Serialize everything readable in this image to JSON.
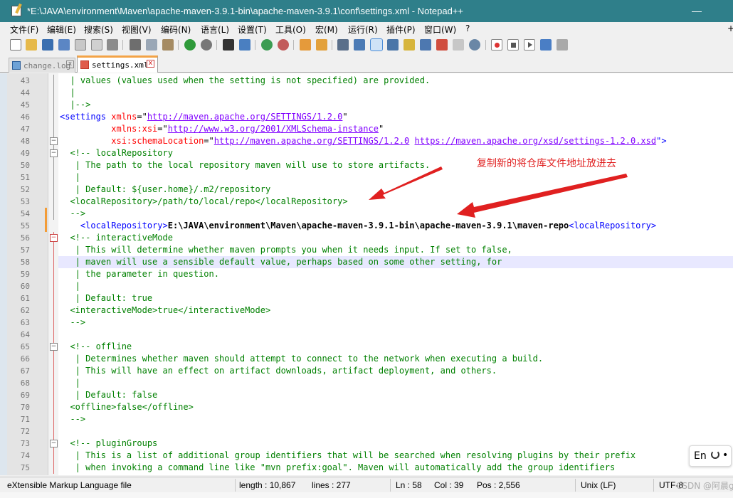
{
  "window": {
    "title": "*E:\\JAVA\\environment\\Maven\\apache-maven-3.9.1-bin\\apache-maven-3.9.1\\conf\\settings.xml - Notepad++",
    "min_glyph": "—"
  },
  "menu": [
    "文件(F)",
    "编辑(E)",
    "搜索(S)",
    "视图(V)",
    "编码(N)",
    "语言(L)",
    "设置(T)",
    "工具(O)",
    "宏(M)",
    "运行(R)",
    "插件(P)",
    "窗口(W)",
    "?"
  ],
  "menu_close": "+",
  "tabs": [
    {
      "label": "change.log",
      "close": "x",
      "active": false
    },
    {
      "label": "settings.xml",
      "close": "x",
      "active": true
    }
  ],
  "lines": [
    {
      "n": "43",
      "segs": [
        {
          "t": "  | values (values used when the setting is not specified) are provided.",
          "c": "cm"
        }
      ]
    },
    {
      "n": "44",
      "segs": [
        {
          "t": "  |",
          "c": "cm"
        }
      ]
    },
    {
      "n": "45",
      "segs": [
        {
          "t": "  |-->",
          "c": "cm"
        }
      ]
    },
    {
      "n": "46",
      "segs": [
        {
          "t": "<settings ",
          "c": "tg"
        },
        {
          "t": "xmlns",
          "c": "at"
        },
        {
          "t": "=\"",
          "c": "tx"
        },
        {
          "t": "http://maven.apache.org/SETTINGS/1.2.0",
          "c": "av"
        },
        {
          "t": "\"",
          "c": "tx"
        }
      ]
    },
    {
      "n": "47",
      "segs": [
        {
          "t": "          ",
          "c": "tx"
        },
        {
          "t": "xmlns:xsi",
          "c": "at"
        },
        {
          "t": "=\"",
          "c": "tx"
        },
        {
          "t": "http://www.w3.org/2001/XMLSchema-instance",
          "c": "av"
        },
        {
          "t": "\"",
          "c": "tx"
        }
      ]
    },
    {
      "n": "48",
      "segs": [
        {
          "t": "          ",
          "c": "tx"
        },
        {
          "t": "xsi:schemaLocation",
          "c": "at"
        },
        {
          "t": "=\"",
          "c": "tx"
        },
        {
          "t": "http://maven.apache.org/SETTINGS/1.2.0",
          "c": "av"
        },
        {
          "t": " ",
          "c": "tx"
        },
        {
          "t": "https://maven.apache.org/xsd/settings-1.2.0.xsd",
          "c": "av"
        },
        {
          "t": "\">",
          "c": "tg"
        }
      ]
    },
    {
      "n": "49",
      "segs": [
        {
          "t": "  <!-- localRepository",
          "c": "cm"
        }
      ]
    },
    {
      "n": "50",
      "segs": [
        {
          "t": "   | The path to the local repository maven will use to store artifacts.",
          "c": "cm"
        }
      ]
    },
    {
      "n": "51",
      "segs": [
        {
          "t": "   |",
          "c": "cm"
        }
      ]
    },
    {
      "n": "52",
      "segs": [
        {
          "t": "   | Default: ${user.home}/.m2/repository",
          "c": "cm"
        }
      ]
    },
    {
      "n": "53",
      "segs": [
        {
          "t": "  <localRepository>/path/to/local/repo</localRepository>",
          "c": "cm"
        }
      ]
    },
    {
      "n": "54",
      "segs": [
        {
          "t": "  -->",
          "c": "cm"
        }
      ]
    },
    {
      "n": "55",
      "segs": [
        {
          "t": "    ",
          "c": "tx"
        },
        {
          "t": "<localRepository>",
          "c": "tg"
        },
        {
          "t": "E:\\JAVA\\environment\\Maven\\apache-maven-3.9.1-bin\\apache-maven-3.9.1\\maven-repo",
          "c": "tx bold"
        },
        {
          "t": "<localRepository>",
          "c": "tg"
        }
      ]
    },
    {
      "n": "56",
      "segs": [
        {
          "t": "  <!-- interactiveMode",
          "c": "cm"
        }
      ]
    },
    {
      "n": "57",
      "segs": [
        {
          "t": "   | This will determine whether maven prompts you when it needs input. If set to false,",
          "c": "cm"
        }
      ]
    },
    {
      "n": "58",
      "segs": [
        {
          "t": "   | maven will use a sensible default value, perhaps based on some other setting, for",
          "c": "cm"
        }
      ]
    },
    {
      "n": "59",
      "segs": [
        {
          "t": "   | the parameter in question.",
          "c": "cm"
        }
      ]
    },
    {
      "n": "60",
      "segs": [
        {
          "t": "   |",
          "c": "cm"
        }
      ]
    },
    {
      "n": "61",
      "segs": [
        {
          "t": "   | Default: true",
          "c": "cm"
        }
      ]
    },
    {
      "n": "62",
      "segs": [
        {
          "t": "  <interactiveMode>true</interactiveMode>",
          "c": "cm"
        }
      ]
    },
    {
      "n": "63",
      "segs": [
        {
          "t": "  -->",
          "c": "cm"
        }
      ]
    },
    {
      "n": "64",
      "segs": [
        {
          "t": "",
          "c": "cm"
        }
      ]
    },
    {
      "n": "65",
      "segs": [
        {
          "t": "  <!-- offline",
          "c": "cm"
        }
      ]
    },
    {
      "n": "66",
      "segs": [
        {
          "t": "   | Determines whether maven should attempt to connect to the network when executing a build.",
          "c": "cm"
        }
      ]
    },
    {
      "n": "67",
      "segs": [
        {
          "t": "   | This will have an effect on artifact downloads, artifact deployment, and others.",
          "c": "cm"
        }
      ]
    },
    {
      "n": "68",
      "segs": [
        {
          "t": "   |",
          "c": "cm"
        }
      ]
    },
    {
      "n": "69",
      "segs": [
        {
          "t": "   | Default: false",
          "c": "cm"
        }
      ]
    },
    {
      "n": "70",
      "segs": [
        {
          "t": "  <offline>false</offline>",
          "c": "cm"
        }
      ]
    },
    {
      "n": "71",
      "segs": [
        {
          "t": "  -->",
          "c": "cm"
        }
      ]
    },
    {
      "n": "72",
      "segs": [
        {
          "t": "",
          "c": "cm"
        }
      ]
    },
    {
      "n": "73",
      "segs": [
        {
          "t": "  <!-- pluginGroups",
          "c": "cm"
        }
      ]
    },
    {
      "n": "74",
      "segs": [
        {
          "t": "   | This is a list of additional group identifiers that will be searched when resolving plugins by their prefix",
          "c": "cm"
        }
      ]
    },
    {
      "n": "75",
      "segs": [
        {
          "t": "   | when invoking a command line like \"mvn prefix:goal\". Maven will automatically add the group identifiers",
          "c": "cm"
        }
      ]
    }
  ],
  "annotation": "复制新的将仓库文件地址放进去",
  "status": {
    "filetype": "eXtensible Markup Language file",
    "length": "length : 10,867",
    "lines": "lines : 277",
    "ln": "Ln : 58",
    "col": "Col : 39",
    "pos": "Pos : 2,556",
    "eol": "Unix (LF)",
    "enc": "UTF-8"
  },
  "ime": {
    "text": "En",
    "dot": "•"
  },
  "watermark": "CSDN @阿晨gg",
  "colors": {
    "titlebar": "#2f7f8a",
    "comment": "#008000",
    "tag": "#0000ff",
    "attr": "#ff0000",
    "value": "#8000ff",
    "annotation": "#e02020"
  }
}
